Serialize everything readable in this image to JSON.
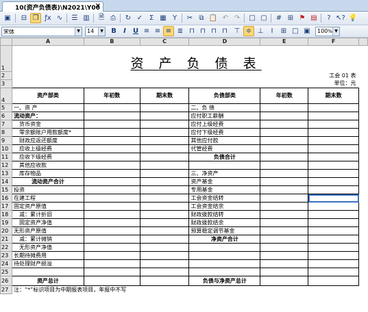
{
  "tab": {
    "title": "10(资产负债表)\\N2021\\Y06",
    "close": "×"
  },
  "font": {
    "name": "宋体",
    "size": "14"
  },
  "zoom": "100",
  "icons": {
    "toolbar1": [
      "save-icon",
      "print-preview-icon",
      "copy-format-icon",
      "formula-icon",
      "link-icon",
      "insert-row-icon",
      "insert-column-icon",
      "preview-icon",
      "print-icon",
      "recalc-icon",
      "audit-icon",
      "sum-icon",
      "calculator-icon",
      "filter-icon",
      "cut-icon",
      "copy-icon",
      "paste-icon",
      "undo-icon",
      "redo-icon",
      "border-icon",
      "frame-icon",
      "grid-icon",
      "table-icon",
      "flag-icon",
      "pdf-icon",
      "help-icon",
      "whats-this-icon",
      "tip-icon"
    ],
    "toolbar2": [
      "bold-icon",
      "italic-icon",
      "underline-icon",
      "align-left-icon",
      "align-center-icon",
      "align-right-icon",
      "justify-icon",
      "merge-icon",
      "merge-cells-icon",
      "merge-rows-icon",
      "split-icon",
      "align-top-icon",
      "align-middle-icon",
      "align-bottom-icon",
      "border-all-icon",
      "border-outer-icon",
      "border-none-icon"
    ]
  },
  "columns": [
    "A",
    "B",
    "C",
    "D",
    "E",
    "F"
  ],
  "sheet": {
    "title": "资 产 负 债 表",
    "form_no": "工会 01 表",
    "unit": "单位：元",
    "header": [
      "资产部类",
      "年初数",
      "期末数",
      "负债部类",
      "年初数",
      "期末数"
    ],
    "rows": [
      {
        "n": "5",
        "a": "一、资 产",
        "d": "二、负 债"
      },
      {
        "n": "6",
        "a": "流动资产：",
        "d": "应付职工薪酬"
      },
      {
        "n": "7",
        "a": "货币资金",
        "d": "应付上级经费"
      },
      {
        "n": "8",
        "a": "零余额账户用款额度*",
        "d": "应付下级经费"
      },
      {
        "n": "9",
        "a": "财政应返还额度",
        "d": "其他应付款"
      },
      {
        "n": "10",
        "a": "应收上级经费",
        "d": "代管经费"
      },
      {
        "n": "11",
        "a": "应收下级经费",
        "d": "负债合计"
      },
      {
        "n": "12",
        "a": "其他应收款",
        "d": ""
      },
      {
        "n": "13",
        "a": "库存物品",
        "d": "三、净资产"
      },
      {
        "n": "14",
        "a": "流动资产合计",
        "d": "资产基金"
      },
      {
        "n": "15",
        "a": "投资",
        "d": "专用基金"
      },
      {
        "n": "16",
        "a": "在建工程",
        "d": "工会资金结转"
      },
      {
        "n": "17",
        "a": "固定资产原值",
        "d": "工会资金结余"
      },
      {
        "n": "18",
        "a": "减：累计折旧",
        "d": "财政拨款结转"
      },
      {
        "n": "19",
        "a": "固定资产净值",
        "d": "财政拨款结余"
      },
      {
        "n": "20",
        "a": "无形资产原值",
        "d": "预算稳定调节基金"
      },
      {
        "n": "21",
        "a": "减：累计摊销",
        "d": "净资产合计"
      },
      {
        "n": "22",
        "a": "无形资产净值",
        "d": ""
      },
      {
        "n": "23",
        "a": "长期待摊费用",
        "d": ""
      },
      {
        "n": "24",
        "a": "待处理财产损溢",
        "d": ""
      },
      {
        "n": "25",
        "a": "",
        "d": ""
      },
      {
        "n": "26",
        "a": "资产总计",
        "d": "负债与净资产总计"
      }
    ],
    "note": "注：“*”标识项目为中期报表项目，年报中不写"
  },
  "selected_cell": "F16"
}
